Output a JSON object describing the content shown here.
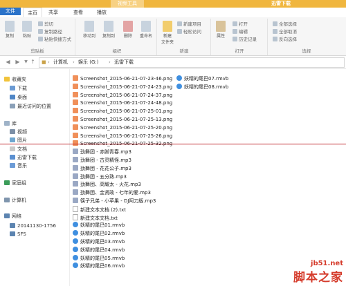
{
  "title_bar": {
    "context_tab": "视频工具",
    "window_title": "迅雷下载"
  },
  "tabs": {
    "file": "文件",
    "home": "主页",
    "share": "共享",
    "view": "查看",
    "play": "播放"
  },
  "ribbon": {
    "clipboard": {
      "label": "剪贴板",
      "copy": "复制",
      "paste": "粘贴",
      "cut": "剪切",
      "copy_path": "复制路径",
      "paste_shortcut": "粘贴快捷方式"
    },
    "organize": {
      "label": "组织",
      "move_to": "移动到",
      "copy_to": "复制到",
      "delete": "删除",
      "rename": "重命名"
    },
    "new": {
      "label": "新建",
      "new_folder": "新建\n文件夹",
      "new_item": "新建项目",
      "easy_access": "轻松访问"
    },
    "open": {
      "label": "打开",
      "properties": "属性",
      "open": "打开",
      "edit": "编辑",
      "history": "历史记录"
    },
    "select": {
      "label": "选择",
      "select_all": "全部选择",
      "select_none": "全部取消",
      "invert": "反向选择"
    }
  },
  "address": {
    "crumbs": [
      "计算机",
      "娱乐 (G:)",
      "迅雷下载"
    ]
  },
  "sidebar": {
    "favorites": "收藏夹",
    "downloads": "下载",
    "desktop": "桌面",
    "recent": "最近访问的位置",
    "libraries": "库",
    "videos": "视频",
    "pictures": "图片",
    "documents": "文档",
    "xunlei": "迅雷下载",
    "music": "音乐",
    "homegroup": "家庭组",
    "computer": "计算机",
    "network": "网络",
    "net_pc": "20141130-1756",
    "net_sfs": "SFS"
  },
  "files_col1": [
    {
      "name": "Screenshot_2015-06-21-07-23-46.png",
      "type": "png"
    },
    {
      "name": "Screenshot_2015-06-21-07-24-23.png",
      "type": "png"
    },
    {
      "name": "Screenshot_2015-06-21-07-24-37.png",
      "type": "png"
    },
    {
      "name": "Screenshot_2015-06-21-07-24-48.png",
      "type": "png"
    },
    {
      "name": "Screenshot_2015-06-21-07-25-01.png",
      "type": "png"
    },
    {
      "name": "Screenshot_2015-06-21-07-25-13.png",
      "type": "png"
    },
    {
      "name": "Screenshot_2015-06-21-07-25-20.png",
      "type": "png"
    },
    {
      "name": "Screenshot_2015-06-21-07-25-26.png",
      "type": "png"
    },
    {
      "name": "Screenshot_2015-06-21-07-25-32.png",
      "type": "png"
    },
    {
      "name": "劲舞团 - 赤脚青春.mp3",
      "type": "mp3"
    },
    {
      "name": "劲舞团 - 古灵精怪.mp3",
      "type": "mp3"
    },
    {
      "name": "劲舞团 - 花花公子.mp3",
      "type": "mp3"
    },
    {
      "name": "劲舞团 - 五分熟.mp3",
      "type": "mp3"
    },
    {
      "name": "劲舞团、高耀太 - 火花.mp3",
      "type": "mp3"
    },
    {
      "name": "劲舞团、金贤政 - 七年的爱.mp3",
      "type": "mp3"
    },
    {
      "name": "筷子兄弟 - 小苹果 - DJ阿刀版.mp3",
      "type": "mp3"
    },
    {
      "name": "新建文本文档 (2).txt",
      "type": "txt"
    },
    {
      "name": "新建文本文档.txt",
      "type": "txt"
    },
    {
      "name": "妖精的尾巴01.rmvb",
      "type": "rmvb"
    },
    {
      "name": "妖精的尾巴02.rmvb",
      "type": "rmvb"
    },
    {
      "name": "妖精的尾巴03.rmvb",
      "type": "rmvb"
    },
    {
      "name": "妖精的尾巴04.rmvb",
      "type": "rmvb"
    },
    {
      "name": "妖精的尾巴05.rmvb",
      "type": "rmvb"
    },
    {
      "name": "妖精的尾巴06.rmvb",
      "type": "rmvb"
    }
  ],
  "files_col2": [
    {
      "name": "妖精的尾巴07.rmvb",
      "type": "rmvb"
    },
    {
      "name": "妖精的尾巴08.rmvb",
      "type": "rmvb"
    }
  ],
  "watermark": {
    "url": "jb51.net",
    "name": "脚本之家"
  }
}
